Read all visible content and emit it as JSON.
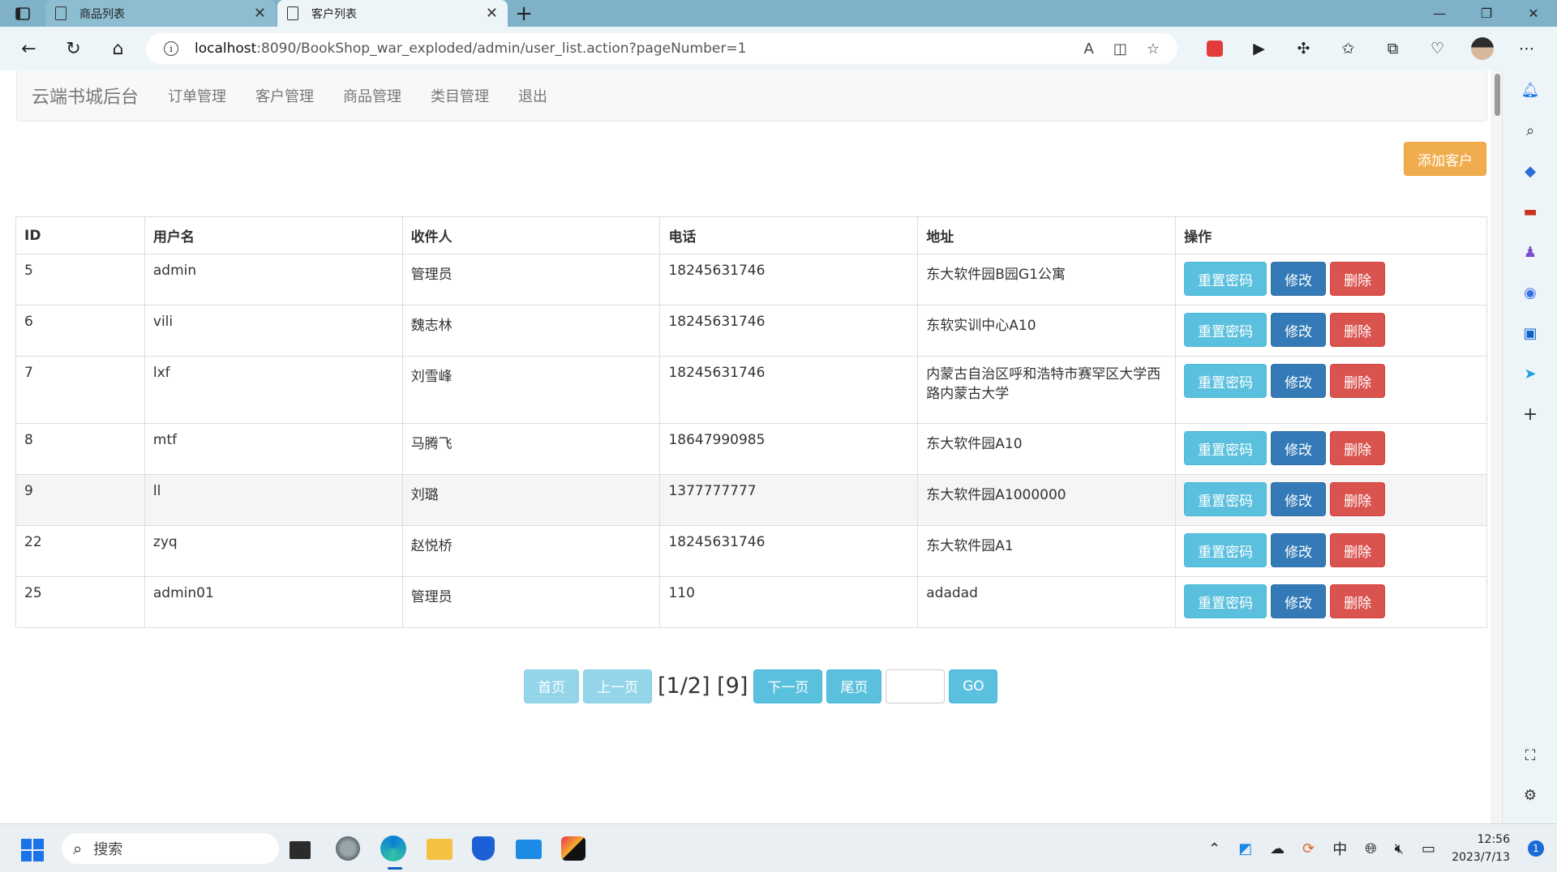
{
  "browser": {
    "tabs": [
      {
        "title": "商品列表",
        "active": false
      },
      {
        "title": "客户列表",
        "active": true
      }
    ],
    "url_host": "localhost",
    "url_path": ":8090/BookShop_war_exploded/admin/user_list.action?pageNumber=1"
  },
  "navbar": {
    "brand": "云端书城后台",
    "links": [
      "订单管理",
      "客户管理",
      "商品管理",
      "类目管理",
      "退出"
    ]
  },
  "add_button": "添加客户",
  "table": {
    "headers": [
      "ID",
      "用户名",
      "收件人",
      "电话",
      "地址",
      "操作"
    ],
    "rows": [
      {
        "id": "5",
        "username": "admin",
        "receiver": "管理员",
        "phone": "18245631746",
        "address": "东大软件园B园G1公寓"
      },
      {
        "id": "6",
        "username": "vili",
        "receiver": "魏志林",
        "phone": "18245631746",
        "address": "东软实训中心A10"
      },
      {
        "id": "7",
        "username": "lxf",
        "receiver": "刘雪峰",
        "phone": "18245631746",
        "address": "内蒙古自治区呼和浩特市赛罕区大学西路内蒙古大学"
      },
      {
        "id": "8",
        "username": "mtf",
        "receiver": "马腾飞",
        "phone": "18647990985",
        "address": "东大软件园A10"
      },
      {
        "id": "9",
        "username": "ll",
        "receiver": "刘璐",
        "phone": "1377777777",
        "address": "东大软件园A1000000"
      },
      {
        "id": "22",
        "username": "zyq",
        "receiver": "赵悦桥",
        "phone": "18245631746",
        "address": "东大软件园A1"
      },
      {
        "id": "25",
        "username": "admin01",
        "receiver": "管理员",
        "phone": "110",
        "address": "adadad"
      }
    ],
    "actions": {
      "reset": "重置密码",
      "edit": "修改",
      "delete": "删除"
    }
  },
  "pager": {
    "first": "首页",
    "prev": "上一页",
    "info": "[1/2] [9]",
    "next": "下一页",
    "last": "尾页",
    "go": "GO"
  },
  "taskbar": {
    "search_placeholder": "搜索",
    "ime": "中",
    "time": "12:56",
    "date": "2023/7/13",
    "notifications": "1"
  },
  "colors": {
    "tabbar": "#7fb2c8",
    "info": "#5bc0de",
    "primary": "#337ab7",
    "danger": "#d9534f",
    "warning": "#f0ad4e"
  }
}
